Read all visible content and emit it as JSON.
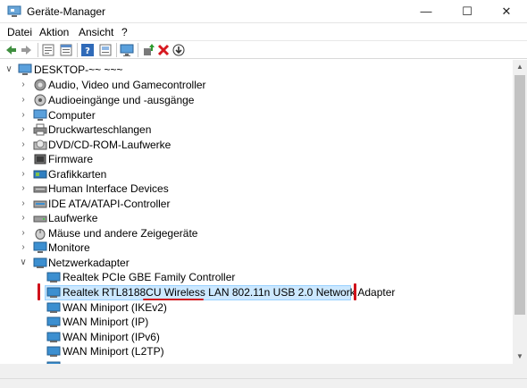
{
  "window": {
    "title": "Geräte-Manager",
    "minimize_symbol": "—",
    "maximize_symbol": "☐",
    "close_symbol": "✕"
  },
  "menu": [
    "Datei",
    "Aktion",
    "Ansicht",
    "?"
  ],
  "toolbar": {
    "icons": [
      "back-icon",
      "forward-icon",
      "properties-view-icon",
      "list-view-icon",
      "help-icon",
      "properties-icon",
      "monitor-icon",
      "update-driver-icon",
      "uninstall-icon",
      "scan-hardware-icon"
    ]
  },
  "tree": {
    "root": "DESKTOP-~~ ~~~",
    "categories": [
      "Audio, Video und Gamecontroller",
      "Audioeingänge und -ausgänge",
      "Computer",
      "Druckwarteschlangen",
      "DVD/CD-ROM-Laufwerke",
      "Firmware",
      "Grafikkarten",
      "Human Interface Devices",
      "IDE ATA/ATAPI-Controller",
      "Laufwerke",
      "Mäuse und andere Zeigegeräte",
      "Monitore",
      "Netzwerkadapter"
    ],
    "network_adapters": [
      "Realtek PCIe GBE Family Controller",
      "Realtek RTL8188CU Wireless LAN 802.11n USB 2.0 Network Adapter",
      "WAN Miniport (IKEv2)",
      "WAN Miniport (IP)",
      "WAN Miniport (IPv6)",
      "WAN Miniport (L2TP)"
    ],
    "selected_item": "Realtek RTL8188CU Wireless LAN 802.11n USB 2.0 Network Adapter"
  },
  "colors": {
    "selection": "#cce8ff",
    "annotation_red": "#d0121b",
    "folder_blue": "#3c8fd0"
  }
}
